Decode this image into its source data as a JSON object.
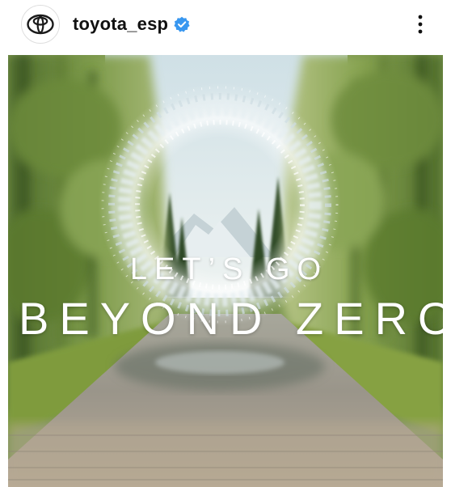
{
  "post": {
    "username": "toyota_esp",
    "verified": true,
    "avatar_icon": "toyota-logo-icon",
    "more_icon": "more-vertical-icon"
  },
  "media": {
    "headline_small": "LET’S GO",
    "headline_large": "BEYOND ZERO"
  },
  "colors": {
    "verified_blue": "#3897f0",
    "text": "#111111"
  }
}
